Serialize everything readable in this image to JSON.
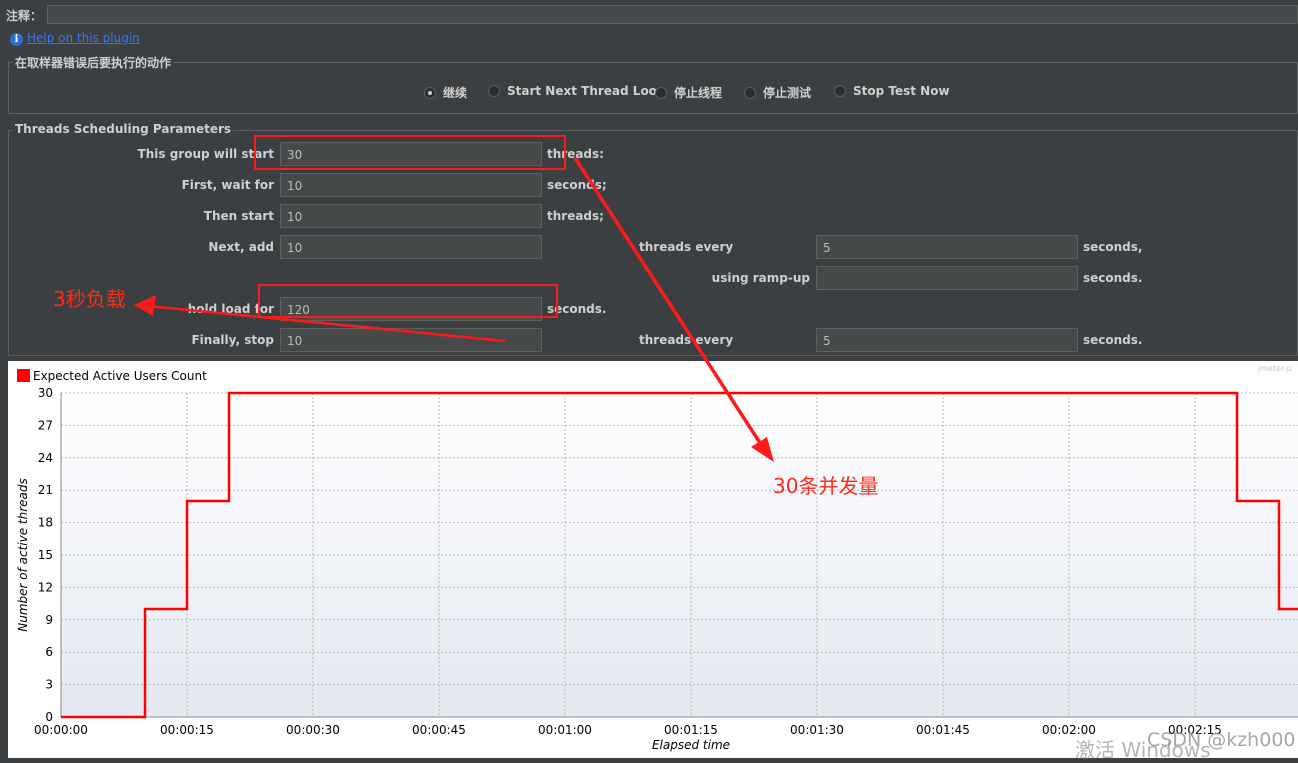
{
  "top": {
    "comment_label": "注释：",
    "help_link": "Help on this plugin"
  },
  "sampler_error": {
    "title": "在取样器错误后要执行的动作",
    "options": [
      {
        "label": "继续",
        "selected": true
      },
      {
        "label": "Start Next Thread Loop",
        "selected": false
      },
      {
        "label": "停止线程",
        "selected": false
      },
      {
        "label": "停止测试",
        "selected": false
      },
      {
        "label": "Stop Test Now",
        "selected": false
      }
    ]
  },
  "scheduling": {
    "title": "Threads Scheduling Parameters",
    "start_label": "This group will start",
    "start_value": "30",
    "start_unit": "threads:",
    "wait_label": "First, wait for",
    "wait_value": "10",
    "wait_unit": "seconds;",
    "then_label": "Then start",
    "then_value": "10",
    "then_unit": "threads;",
    "next_label": "Next, add",
    "next_value": "10",
    "next_every_label": "threads every",
    "next_every_value": "5",
    "next_every_unit": "seconds,",
    "rampup_label": "using ramp-up",
    "rampup_value": "",
    "rampup_unit": "seconds.",
    "hold_label": "hold load for",
    "hold_value": "120",
    "hold_unit": "seconds.",
    "stop_label": "Finally, stop",
    "stop_value": "10",
    "stop_every_label": "threads every",
    "stop_every_value": "5",
    "stop_every_unit": "seconds."
  },
  "annotations": {
    "hold_note": "3秒负载",
    "concurrency_note": "30条并发量",
    "color": "#ff1a1a"
  },
  "chart_data": {
    "type": "line",
    "legend": [
      "Expected Active Users Count"
    ],
    "series": [
      {
        "name": "Expected Active Users Count",
        "color": "#ff0000",
        "points": [
          [
            0,
            0
          ],
          [
            10,
            0
          ],
          [
            10,
            10
          ],
          [
            15,
            10
          ],
          [
            15,
            20
          ],
          [
            20,
            20
          ],
          [
            20,
            30
          ],
          [
            140,
            30
          ],
          [
            140,
            20
          ],
          [
            145,
            20
          ],
          [
            145,
            10
          ],
          [
            150,
            10
          ]
        ]
      }
    ],
    "xlabel": "Elapsed time",
    "ylabel": "Number of active threads",
    "xlim": [
      0,
      150
    ],
    "ylim": [
      0,
      30
    ],
    "xticks": [
      0,
      15,
      30,
      45,
      60,
      75,
      90,
      105,
      120,
      135
    ],
    "xtick_labels": [
      "00:00:00",
      "00:00:15",
      "00:00:30",
      "00:00:45",
      "00:01:00",
      "00:01:15",
      "00:01:30",
      "00:01:45",
      "00:02:00",
      "00:02:15"
    ],
    "yticks": [
      0,
      3,
      6,
      9,
      12,
      15,
      18,
      21,
      24,
      27,
      30
    ],
    "grid": true,
    "corner_text": "jmeter-p"
  },
  "watermark": {
    "left": "激活 Windows",
    "right": "CSDN @kzh000"
  },
  "colors": {
    "panel_bg": "#3c3f41",
    "field_bg": "#45494a",
    "link": "#2f7bff",
    "series_red": "#ff0000"
  }
}
